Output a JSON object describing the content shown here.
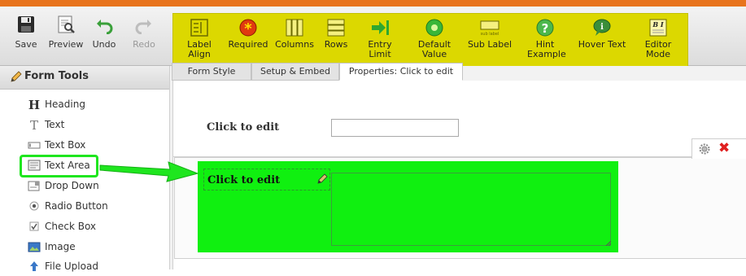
{
  "toolbar": {
    "left_buttons": [
      {
        "label": "Save",
        "icon": "floppy-disk-icon",
        "enabled": true
      },
      {
        "label": "Preview",
        "icon": "preview-icon",
        "enabled": true
      },
      {
        "label": "Undo",
        "icon": "undo-icon",
        "enabled": true
      },
      {
        "label": "Redo",
        "icon": "redo-icon",
        "enabled": false
      }
    ],
    "property_buttons": [
      {
        "label": "Label Align",
        "icon": "label-align-icon"
      },
      {
        "label": "Required",
        "icon": "required-asterisk-icon"
      },
      {
        "label": "Columns",
        "icon": "columns-icon"
      },
      {
        "label": "Rows",
        "icon": "rows-icon"
      },
      {
        "label": "Entry Limit",
        "icon": "entry-limit-icon"
      },
      {
        "label": "Default Value",
        "icon": "default-value-icon"
      },
      {
        "label": "Sub Label",
        "icon": "sub-label-icon",
        "icon_text": "sub label"
      },
      {
        "label": "Hint Example",
        "icon": "hint-question-icon"
      },
      {
        "label": "Hover Text",
        "icon": "hover-text-bubble-icon"
      },
      {
        "label": "Editor Mode",
        "icon": "editor-mode-icon",
        "icon_text": "B I"
      }
    ],
    "highlight_color": "#dcd800"
  },
  "sidebar": {
    "title": "Form Tools",
    "tools": [
      {
        "label": "Heading",
        "icon": "heading-icon"
      },
      {
        "label": "Text",
        "icon": "text-icon"
      },
      {
        "label": "Text Box",
        "icon": "textbox-icon"
      },
      {
        "label": "Text Area",
        "icon": "textarea-icon",
        "highlighted": true
      },
      {
        "label": "Drop Down",
        "icon": "dropdown-icon"
      },
      {
        "label": "Radio Button",
        "icon": "radio-button-icon"
      },
      {
        "label": "Check Box",
        "icon": "checkbox-icon"
      },
      {
        "label": "Image",
        "icon": "image-icon"
      },
      {
        "label": "File Upload",
        "icon": "file-upload-icon"
      }
    ]
  },
  "tabs": [
    {
      "label": "Form Style",
      "active": false
    },
    {
      "label": "Setup & Embed",
      "active": false
    },
    {
      "label": "Properties: Click to edit",
      "active": true
    }
  ],
  "form": {
    "question1": {
      "label": "Click to edit",
      "value": ""
    },
    "question2": {
      "label": "Click to edit",
      "value": ""
    }
  },
  "colors": {
    "accent_orange": "#e8741c",
    "selection_green": "#10f010",
    "delete_red": "#e02020"
  }
}
